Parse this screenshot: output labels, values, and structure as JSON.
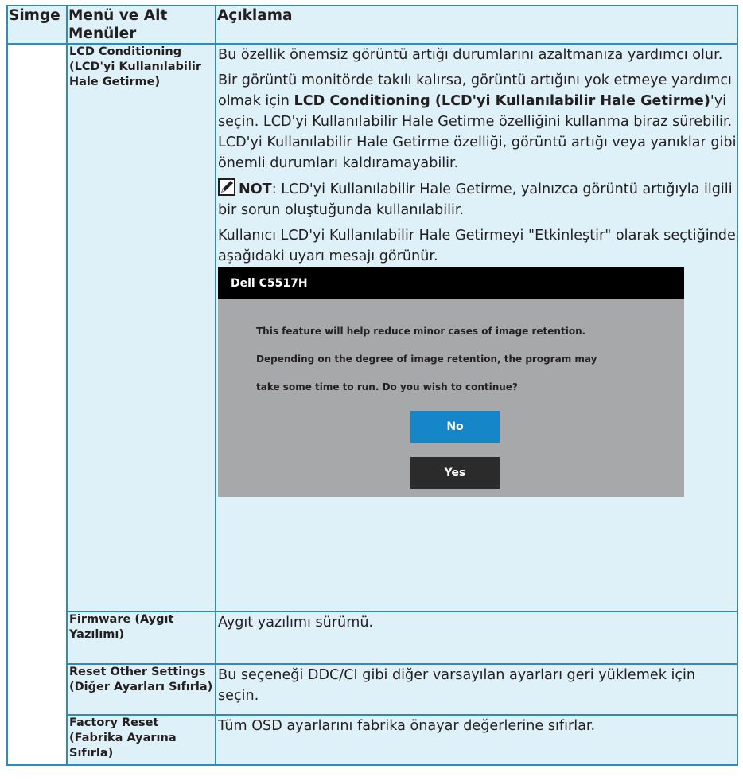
{
  "header": {
    "icon_col": "Simge",
    "menu_col": "Menü ve Alt Menüler",
    "desc_col": "Açıklama"
  },
  "rows": {
    "lcd": {
      "menu": "LCD Conditioning (LCD'yi Kullanılabilir Hale Getirme)",
      "p1": "Bu özellik önemsiz görüntü artığı durumlarını azaltmanıza yardımcı olur.",
      "p2_a": "Bir görüntü monitörde takılı kalırsa, görüntü artığını yok etmeye yardımcı olmak için ",
      "p2_bold": "LCD Conditioning (LCD'yi Kullanılabilir Hale Getirme)",
      "p2_b": "'yi seçin. LCD'yi Kullanılabilir Hale Getirme özelliğini kullanma biraz sürebilir. LCD'yi Kullanılabilir Hale Getirme özelliği, görüntü artığı veya yanıklar gibi önemli durumları kaldıramayabilir.",
      "note_label": "NOT",
      "note_text": ": LCD'yi Kullanılabilir Hale Getirme, yalnızca görüntü artığıyla ilgili bir sorun oluştuğunda kullanılabilir.",
      "p4": "Kullanıcı LCD'yi Kullanılabilir Hale Getirmeyi \"Etkinleştir\" olarak seçtiğinde aşağıdaki uyarı mesajı görünür."
    },
    "firmware": {
      "menu": "Firmware (Aygıt Yazılımı)",
      "desc": "Aygıt yazılımı sürümü."
    },
    "reset_other": {
      "menu": "Reset Other Settings (Diğer Ayarları Sıfırla)",
      "desc": "Bu seçeneği DDC/CI gibi diğer varsayılan ayarları geri yüklemek için seçin."
    },
    "factory_reset": {
      "menu": "Factory Reset (Fabrika Ayarına Sıfırla)",
      "desc": "Tüm OSD ayarlarını fabrika önayar değerlerine sıfırlar."
    }
  },
  "dialog": {
    "title": "Dell C5517H",
    "line1": "This feature will help reduce minor cases of image retention.",
    "line2": "Depending on the degree of image retention, the program may",
    "line3": "take some time to run. Do you wish to continue?",
    "no_label": "No",
    "yes_label": "Yes"
  },
  "icons": {
    "note": "note-pencil-icon"
  },
  "colors": {
    "border": "#2e8bc0",
    "cell_bg": "#dff1f8",
    "dialog_bg": "#a6a8a9",
    "no_button": "#1587c9",
    "yes_button": "#2b2b2b"
  }
}
